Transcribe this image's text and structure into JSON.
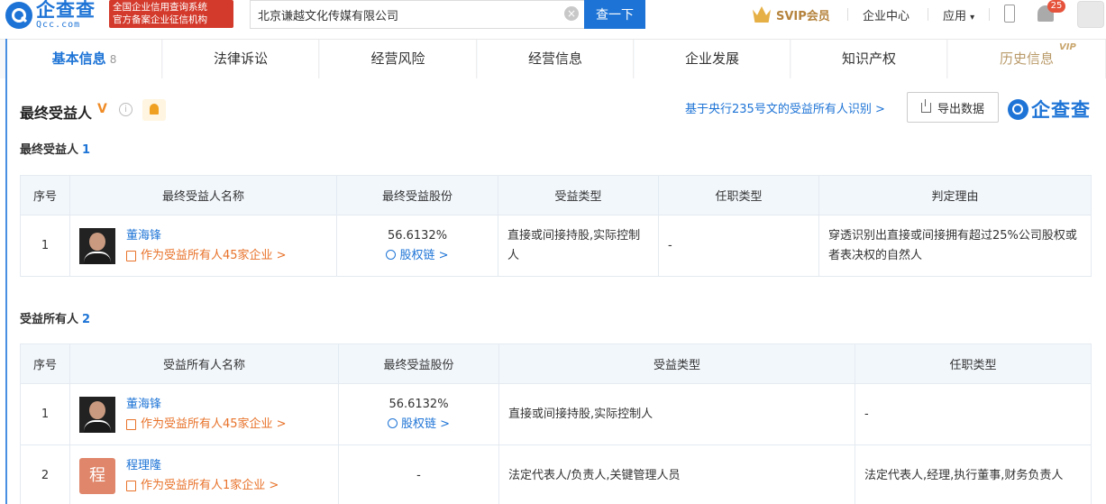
{
  "header": {
    "logo_cn": "企查查",
    "logo_en": "Qcc.com",
    "badge_line1": "全国企业信用查询系统",
    "badge_line2": "官方备案企业征信机构",
    "search_value": "北京谦越文化传媒有限公司",
    "search_button": "查一下",
    "svip_label": "SVIP会员",
    "enterprise_center": "企业中心",
    "apps_label": "应用",
    "apps_caret": "▾",
    "notification_count": "25"
  },
  "tabs": [
    {
      "label": "基本信息",
      "count": "8"
    },
    {
      "label": "法律诉讼"
    },
    {
      "label": "经营风险"
    },
    {
      "label": "经营信息"
    },
    {
      "label": "企业发展"
    },
    {
      "label": "知识产权"
    },
    {
      "label": "历史信息",
      "tag": "VIP"
    }
  ],
  "section": {
    "title": "最终受益人",
    "v_mark": "V",
    "info_mark": "i",
    "law_link": "基于央行235号文的受益所有人识别 >",
    "export_label": "导出数据",
    "brand_text": "企查查"
  },
  "table1": {
    "subtitle": "最终受益人",
    "count": "1",
    "headers": [
      "序号",
      "最终受益人名称",
      "最终受益股份",
      "受益类型",
      "任职类型",
      "判定理由"
    ],
    "rows": [
      {
        "index": "1",
        "name": "董海锋",
        "link": "作为受益所有人45家企业 >",
        "share": "56.6132%",
        "share_link": "股权链 >",
        "type": "直接或间接持股,实际控制人",
        "position": "-",
        "reason": "穿透识别出直接或间接拥有超过25%公司股权或者表决权的自然人"
      }
    ]
  },
  "table2": {
    "subtitle": "受益所有人",
    "count": "2",
    "headers": [
      "序号",
      "受益所有人名称",
      "最终受益股份",
      "受益类型",
      "任职类型"
    ],
    "rows": [
      {
        "index": "1",
        "name": "董海锋",
        "link": "作为受益所有人45家企业 >",
        "share": "56.6132%",
        "share_link": "股权链 >",
        "type": "直接或间接持股,实际控制人",
        "position": "-"
      },
      {
        "index": "2",
        "avatar_char": "程",
        "name": "程理隆",
        "link": "作为受益所有人1家企业 >",
        "share": "-",
        "type": "法定代表人/负责人,关键管理人员",
        "position": "法定代表人,经理,执行董事,财务负责人"
      }
    ]
  }
}
